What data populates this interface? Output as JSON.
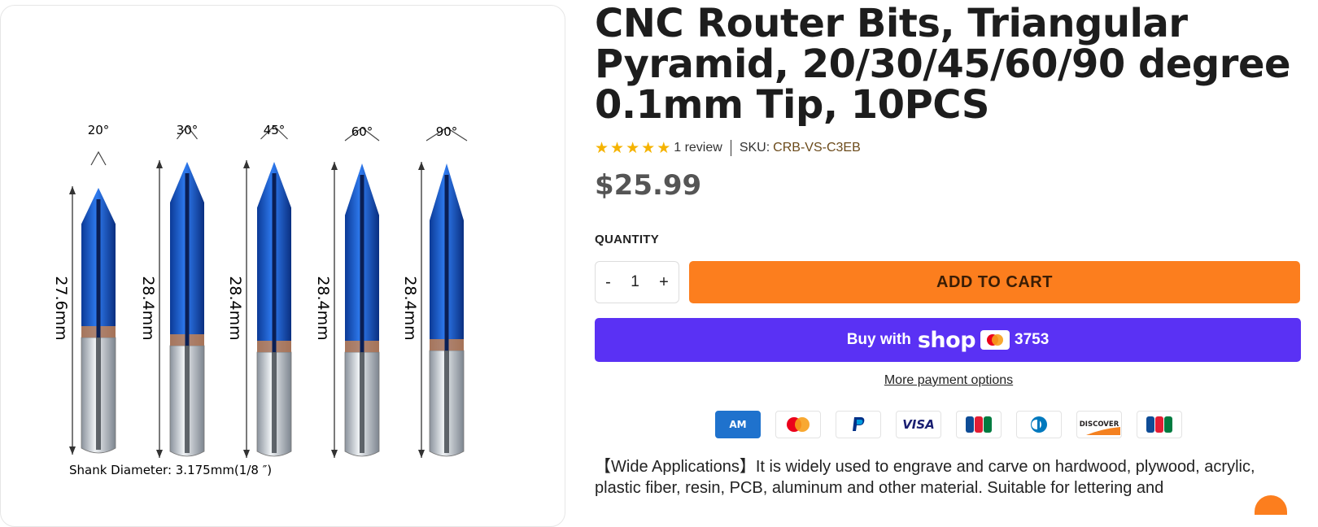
{
  "product": {
    "title": "CNC Router Bits, Triangular Pyramid, 20/30/45/60/90 degree 0.1mm Tip, 10PCS",
    "rating": 5,
    "review_text": "1 review",
    "sku_label": "SKU:",
    "sku": "CRB-VS-C3EB",
    "price": "$25.99"
  },
  "image": {
    "angles": [
      "20°",
      "30°",
      "45°",
      "60°",
      "90°"
    ],
    "lengths": [
      "27.6mm",
      "28.4mm",
      "28.4mm",
      "28.4mm",
      "28.4mm"
    ],
    "shank_text": "Shank Diameter:  3.175mm(1/8  ″)"
  },
  "purchase": {
    "quantity_label": "QUANTITY",
    "minus": "-",
    "quantity": "1",
    "plus": "+",
    "add_to_cart": "ADD TO CART",
    "shop_prefix": "Buy with",
    "shop_logo": "shop",
    "card_last4": "3753",
    "more_payment": "More payment options"
  },
  "payment_icons": [
    "amex-icon",
    "mastercard-icon",
    "paypal-icon",
    "visa-icon",
    "jcb-icon",
    "diners-icon",
    "discover-icon",
    "jcb-icon"
  ],
  "description": "【Wide Applications】It is widely used to engrave and carve on hardwood, plywood, acrylic, plastic fiber, resin, PCB, aluminum and other material. Suitable for lettering and",
  "colors": {
    "accent": "#fc7e1e",
    "shop_purple": "#5a31f4",
    "star": "#f5b300"
  }
}
